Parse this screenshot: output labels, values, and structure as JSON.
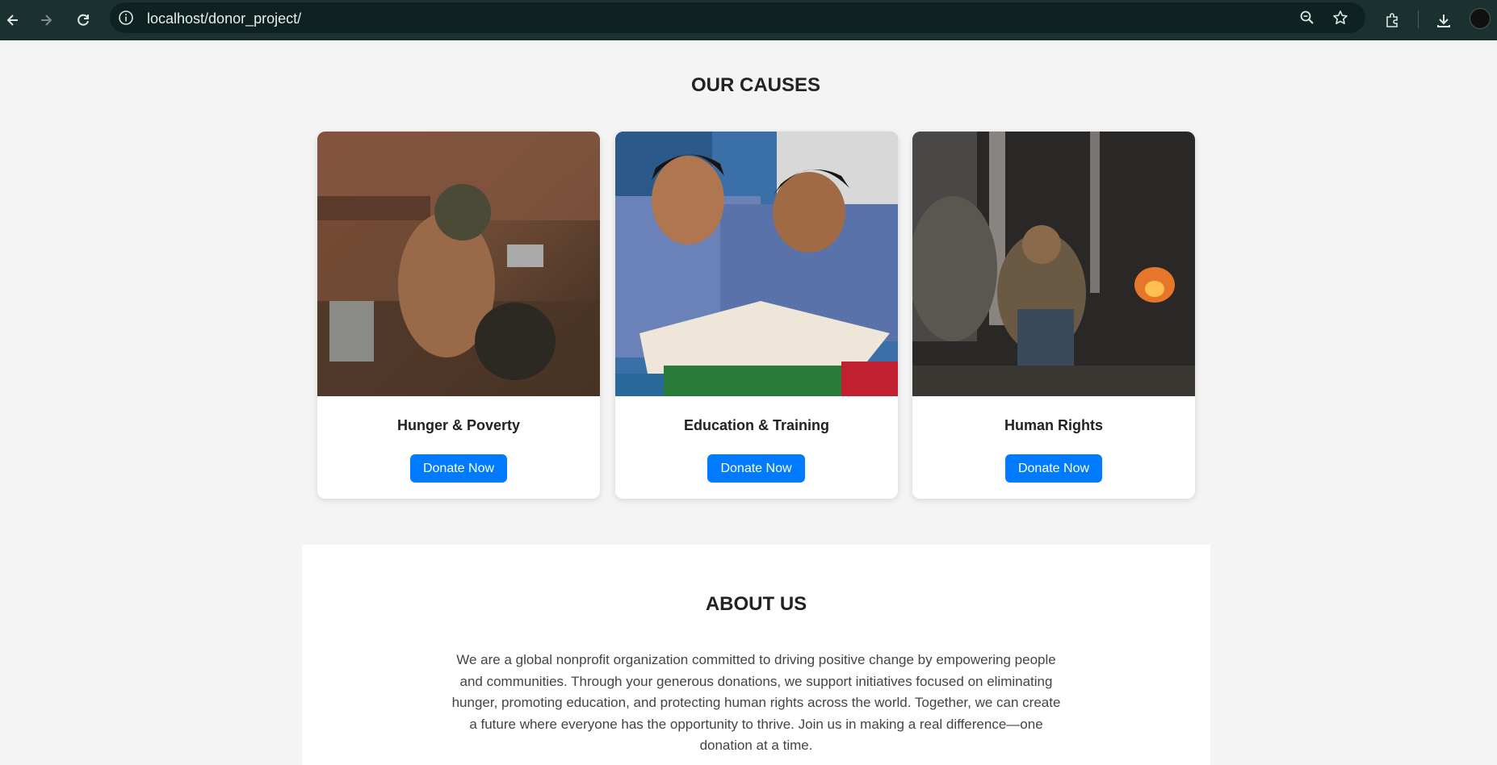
{
  "browser": {
    "url": "localhost/donor_project/",
    "icons": [
      "back-arrow-icon",
      "forward-arrow-icon",
      "reload-icon",
      "info-icon",
      "zoom-icon",
      "star-icon",
      "extensions-icon",
      "download-icon",
      "profile-avatar"
    ]
  },
  "causes": {
    "title": "OUR CAUSES",
    "cards": [
      {
        "title": "Hunger & Poverty",
        "button": "Donate Now",
        "image": "child-with-pots-photo"
      },
      {
        "title": "Education & Training",
        "button": "Donate Now",
        "image": "students-reading-photo"
      },
      {
        "title": "Human Rights",
        "button": "Donate Now",
        "image": "man-sitting-street-photo"
      }
    ]
  },
  "about": {
    "title": "ABOUT US",
    "text": "We are a global nonprofit organization committed to driving positive change by empowering people and communities. Through your generous donations, we support initiatives focused on eliminating hunger, promoting education, and protecting human rights across the world. Together, we can create a future where everyone has the opportunity to thrive. Join us in making a real difference—one donation at a time."
  },
  "colors": {
    "toolbar": "#1b3130",
    "button": "#007bff",
    "page_bg": "#f4f4f4"
  }
}
